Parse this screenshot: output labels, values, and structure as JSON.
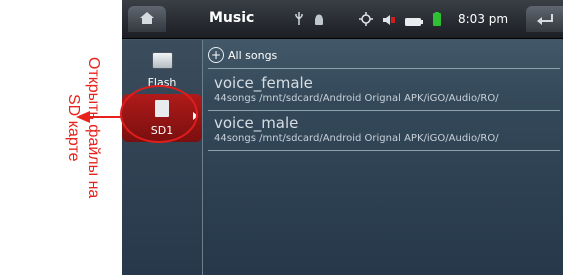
{
  "annotation": {
    "text": "Открыть файлы на\nSD карте"
  },
  "statusbar": {
    "title": "Music",
    "time": "8:03 pm",
    "icons": [
      "usb-icon",
      "android-icon",
      "gps-icon",
      "volume-icon",
      "battery-icon",
      "battery-charging-icon"
    ]
  },
  "storage": {
    "items": [
      {
        "label": "Flash",
        "icon": "flash-drive-icon"
      },
      {
        "label": "SD1",
        "icon": "sd-card-icon",
        "selected": true
      }
    ]
  },
  "list": {
    "all_songs_label": "All songs",
    "rows": [
      {
        "title": "voice_female",
        "subtitle": "44songs /mnt/sdcard/Android Orignal APK/iGO/Audio/RO/"
      },
      {
        "title": "voice_male",
        "subtitle": "44songs /mnt/sdcard/Android Orignal APK/iGO/Audio/RO/"
      }
    ]
  },
  "colors": {
    "annotation_red": "#e8231e",
    "selected_red": "#b01a1a"
  }
}
